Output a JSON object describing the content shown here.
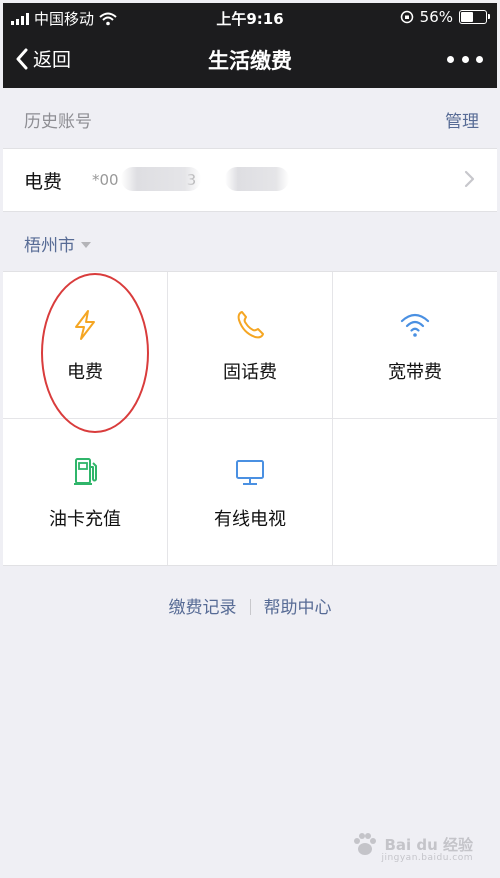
{
  "status_bar": {
    "carrier": "中国移动",
    "time": "上午9:16",
    "battery": "56%",
    "battery_level": 0.56
  },
  "nav": {
    "back_label": "返回",
    "title": "生活缴费"
  },
  "history": {
    "label": "历史账号",
    "manage_label": "管理",
    "account": {
      "name": "电费",
      "number_prefix": "*00",
      "number_suffix": "3"
    }
  },
  "city": "梧州市",
  "services": [
    {
      "label": "电费",
      "icon": "lightning-icon",
      "color": "#f5a623"
    },
    {
      "label": "固话费",
      "icon": "phone-icon",
      "color": "#f5a623"
    },
    {
      "label": "宽带费",
      "icon": "wifi-icon",
      "color": "#4a90e2"
    },
    {
      "label": "油卡充值",
      "icon": "fuel-pump-icon",
      "color": "#2fb56a"
    },
    {
      "label": "有线电视",
      "icon": "tv-icon",
      "color": "#4a90e2"
    }
  ],
  "footer": {
    "records_label": "缴费记录",
    "help_label": "帮助中心"
  },
  "watermark": {
    "brand": "Bai du 经验",
    "url": "jingyan.baidu.com"
  },
  "colors": {
    "link": "#576b95",
    "nav_bg": "#1c1c1e",
    "annotation": "#d93c3c"
  }
}
